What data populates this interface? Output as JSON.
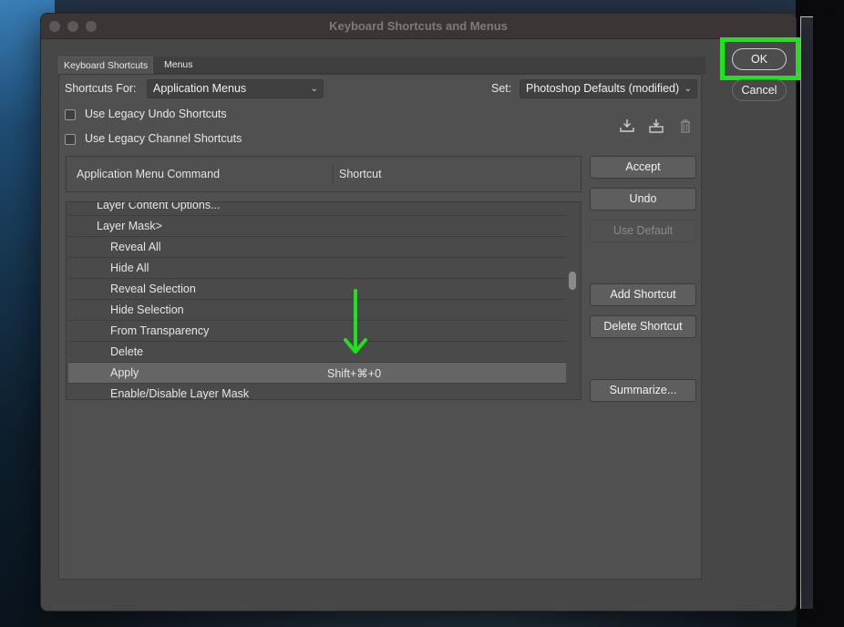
{
  "window": {
    "title": "Keyboard Shortcuts and Menus"
  },
  "tabs": [
    {
      "label": "Keyboard Shortcuts",
      "active": true
    },
    {
      "label": "Menus",
      "active": false
    }
  ],
  "shortcuts_for": {
    "label": "Shortcuts For:",
    "value": "Application Menus"
  },
  "set": {
    "label": "Set:",
    "value": "Photoshop Defaults (modified)"
  },
  "options": [
    {
      "label": "Use Legacy Undo Shortcuts",
      "checked": false
    },
    {
      "label": "Use Legacy Channel Shortcuts",
      "checked": false
    }
  ],
  "set_icons": [
    "save-set-icon",
    "new-set-icon",
    "delete-set-icon"
  ],
  "table": {
    "headers": [
      "Application Menu Command",
      "Shortcut"
    ],
    "rows": [
      {
        "name": "Layer Content Options...",
        "shortcut": ""
      },
      {
        "name": "Layer Mask>",
        "shortcut": ""
      },
      {
        "name": "Reveal All",
        "shortcut": ""
      },
      {
        "name": "Hide All",
        "shortcut": ""
      },
      {
        "name": "Reveal Selection",
        "shortcut": ""
      },
      {
        "name": "Hide Selection",
        "shortcut": ""
      },
      {
        "name": "From Transparency",
        "shortcut": ""
      },
      {
        "name": "Delete",
        "shortcut": ""
      },
      {
        "name": "Apply",
        "shortcut": "Shift+⌘+0",
        "selected": true
      },
      {
        "name": "Enable/Disable Layer Mask",
        "shortcut": ""
      }
    ]
  },
  "side_buttons": {
    "accept": "Accept",
    "undo": "Undo",
    "use_default": "Use Default",
    "add_shortcut": "Add Shortcut",
    "delete_shortcut": "Delete Shortcut",
    "summarize": "Summarize..."
  },
  "dialog_buttons": {
    "ok": "OK",
    "cancel": "Cancel"
  },
  "colors": {
    "highlight": "#1ee51a",
    "arrow": "#22e01d",
    "dialog_bg": "#474747"
  }
}
